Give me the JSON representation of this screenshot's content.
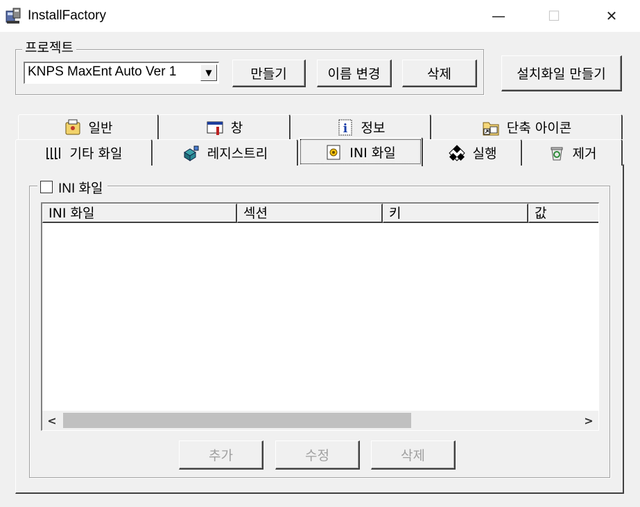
{
  "window": {
    "title": "InstallFactory",
    "minimize_glyph": "—",
    "maximize_glyph": "☐",
    "close_glyph": "✕"
  },
  "project": {
    "legend": "프로젝트",
    "selected": "KNPS MaxEnt Auto Ver 1",
    "buttons": {
      "create": "만들기",
      "rename": "이름 변경",
      "delete": "삭제"
    }
  },
  "build_installer_label": "설치화일 만들기",
  "tabs": {
    "row1": [
      {
        "label": "일반",
        "icon": "general-icon"
      },
      {
        "label": "창",
        "icon": "window-icon"
      },
      {
        "label": "정보",
        "icon": "info-icon"
      },
      {
        "label": "단축 아이콘",
        "icon": "shortcut-icon"
      }
    ],
    "row2": [
      {
        "label": "기타 화일",
        "icon": "files-icon"
      },
      {
        "label": "레지스트리",
        "icon": "registry-icon"
      },
      {
        "label": "INI 화일",
        "icon": "ini-icon",
        "active": true
      },
      {
        "label": "실행",
        "icon": "run-icon"
      },
      {
        "label": "제거",
        "icon": "uninstall-icon"
      }
    ]
  },
  "ini_panel": {
    "checkbox_label": "INI 화일",
    "checked": false,
    "columns": [
      "INI 화일",
      "섹션",
      "키",
      "값"
    ],
    "rows": [],
    "buttons": {
      "add": "추가",
      "edit": "수정",
      "delete": "삭제"
    },
    "buttons_enabled": false
  },
  "colors": {
    "face": "#f0f0f0",
    "shadow": "#404040",
    "disabled_text": "#a0a0a0"
  }
}
